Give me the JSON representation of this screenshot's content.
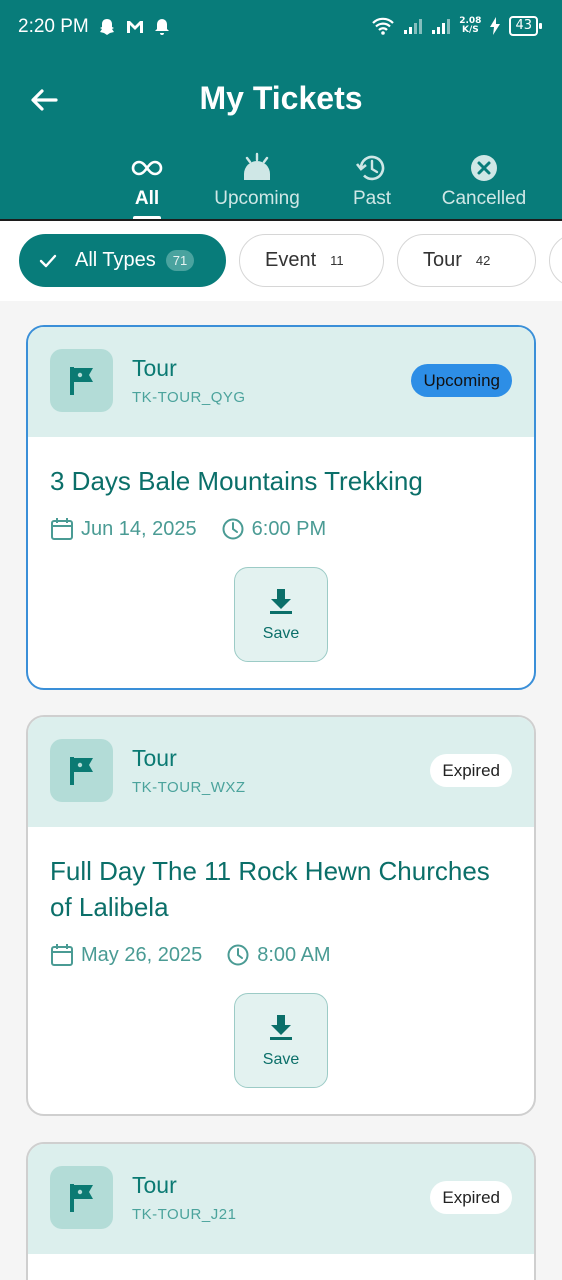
{
  "status_bar": {
    "time": "2:20 PM",
    "net_speed_value": "2.08",
    "net_speed_unit": "K/S",
    "battery": "43"
  },
  "header": {
    "title": "My Tickets"
  },
  "tabs": [
    {
      "label": "All",
      "icon": "infinity-icon",
      "active": true
    },
    {
      "label": "Upcoming",
      "icon": "sunrise-icon",
      "active": false
    },
    {
      "label": "Past",
      "icon": "history-icon",
      "active": false
    },
    {
      "label": "Cancelled",
      "icon": "cancel-circle-icon",
      "active": false
    }
  ],
  "filters": [
    {
      "label": "All Types",
      "count": "71",
      "active": true
    },
    {
      "label": "Event",
      "count": "11",
      "active": false
    },
    {
      "label": "Tour",
      "count": "42",
      "active": false
    }
  ],
  "tickets": [
    {
      "type": "Tour",
      "code": "TK-TOUR_QYG",
      "status": "Upcoming",
      "title": "3 Days Bale Mountains Trekking",
      "date": "Jun 14, 2025",
      "time": "6:00 PM",
      "save_label": "Save"
    },
    {
      "type": "Tour",
      "code": "TK-TOUR_WXZ",
      "status": "Expired",
      "title": "Full Day The 11 Rock Hewn Churches of Lalibela",
      "date": "May 26, 2025",
      "time": "8:00 AM",
      "save_label": "Save"
    },
    {
      "type": "Tour",
      "code": "TK-TOUR_J21",
      "status": "Expired"
    }
  ],
  "colors": {
    "primary": "#087c7a",
    "upcoming_badge": "#2d8ee6",
    "card_head": "#dcefed"
  }
}
